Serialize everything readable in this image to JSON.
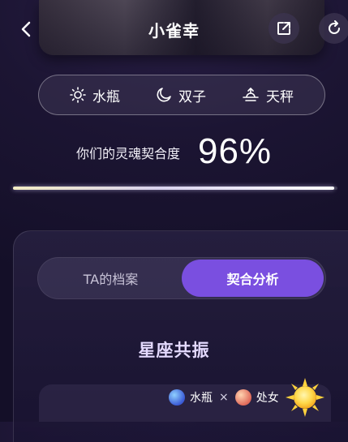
{
  "header": {
    "title": "小雀幸",
    "back_icon": "chevron-left-icon",
    "share_icon": "share-icon",
    "refresh_icon": "refresh-icon"
  },
  "signs": [
    {
      "icon": "sun-icon",
      "name": "水瓶"
    },
    {
      "icon": "moon-icon",
      "name": "双子"
    },
    {
      "icon": "sunrise-icon",
      "name": "天秤"
    }
  ],
  "compatibility": {
    "label": "你们的灵魂契合度",
    "value": "96%",
    "progress": 0.99
  },
  "tabs": {
    "profile": "TA的档案",
    "analysis": "契合分析",
    "active": "analysis"
  },
  "resonance": {
    "title": "星座共振",
    "sign_a": "水瓶",
    "separator": "×",
    "sign_b": "处女"
  },
  "colors": {
    "accent": "#7a4fe0",
    "background": "#1c1533"
  }
}
